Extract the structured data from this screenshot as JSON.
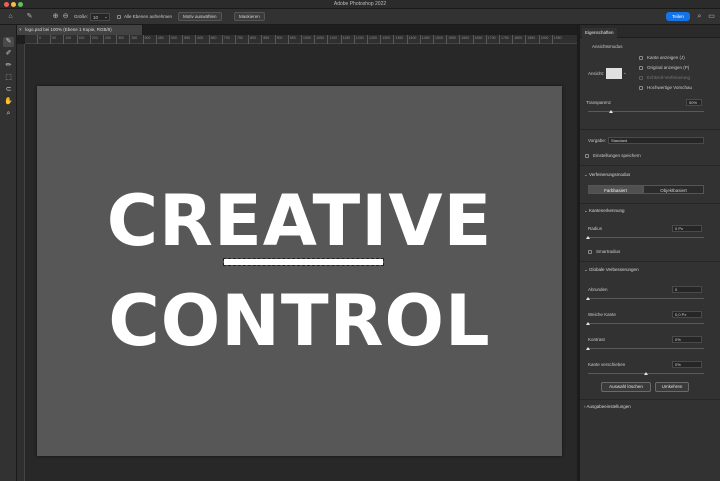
{
  "window": {
    "title": "Adobe Photoshop 2022",
    "traffic_colors": [
      "#ee5f57",
      "#f5bd4f",
      "#5fc453"
    ]
  },
  "optionsbar": {
    "size_label": "Größe:",
    "size_value": "10",
    "all_layers_label": "Alle Ebenen aufnehmen",
    "select_subject": "Motiv auswählen",
    "refine": "Maskieren",
    "share": "Teilen"
  },
  "document": {
    "tab_title": "logo.psd bei 100% (Ebene 1 Kopie, RGB/8)"
  },
  "ruler_ticks": [
    "0",
    "50",
    "100",
    "150",
    "200",
    "250",
    "300",
    "350",
    "400",
    "450",
    "500",
    "550",
    "600",
    "650",
    "700",
    "750",
    "800",
    "850",
    "900",
    "950",
    "1000",
    "1050",
    "1100",
    "1150",
    "1200",
    "1250",
    "1300",
    "1350",
    "1400",
    "1450",
    "1500",
    "1550",
    "1600",
    "1650",
    "1700",
    "1750",
    "1800",
    "1850",
    "1900",
    "1950"
  ],
  "canvas": {
    "line1": "CREATIVE",
    "line2": "CONTROL"
  },
  "panel": {
    "tab": "Eigenschaften",
    "view_mode_title": "Ansichtsmodus",
    "view_label": "Ansicht:",
    "show_edges": "Kante anzeigen (J)",
    "show_original": "Original anzeigen (P)",
    "realtime_refine": "Echtzeit-Verfeinerung",
    "hq_preview": "Hochwertige Vorschau",
    "transparency_label": "Transparenz",
    "transparency_value": "50%",
    "transparency_fraction": 0.2,
    "preset_label": "Vorgabe:",
    "preset_value": "Standard",
    "remember_settings": "Einstellungen speichern",
    "refine_mode_title": "Verfeinerungsmodus",
    "color_aware": "Farbbasiert",
    "object_aware": "Objektbasiert",
    "edge_detection_title": "Kantenerkennung",
    "radius_label": "Radius",
    "radius_value": "0 Px",
    "radius_fraction": 0.0,
    "smart_radius": "Smartradius",
    "global_refinements_title": "Globale Verbesserungen",
    "smooth_label": "Abrunden",
    "smooth_value": "0",
    "smooth_fraction": 0.0,
    "feather_label": "Weiche Kante",
    "feather_value": "0,0 Px",
    "feather_fraction": 0.0,
    "contrast_label": "Kontrast",
    "contrast_value": "0%",
    "contrast_fraction": 0.0,
    "shift_edge_label": "Kante verschieben",
    "shift_edge_value": "0%",
    "shift_edge_fraction": 0.5,
    "clear_selection": "Auswahl löschen",
    "invert": "Umkehren",
    "output_settings_title": "Ausgabeeinstellungen"
  }
}
